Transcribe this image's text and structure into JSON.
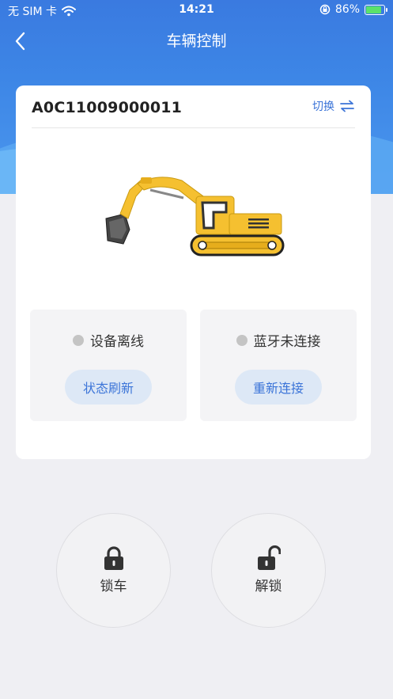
{
  "status_bar": {
    "carrier": "无 SIM 卡",
    "time": "14:21",
    "battery_percent": "86%"
  },
  "navbar": {
    "title": "车辆控制"
  },
  "card": {
    "device_id": "A0C11009000011",
    "switch_label": "切换",
    "device_status": {
      "text": "设备离线",
      "button": "状态刷新"
    },
    "bluetooth_status": {
      "text": "蓝牙未连接",
      "button": "重新连接"
    }
  },
  "actions": {
    "lock_label": "锁车",
    "unlock_label": "解锁"
  },
  "colors": {
    "header_blue": "#3a7ae0",
    "accent_blue": "#3b74d8",
    "button_bg": "#dde8f6",
    "excavator_yellow": "#f5c030",
    "battery_green": "#5be26a",
    "offline_dot": "#c4c4c4"
  }
}
